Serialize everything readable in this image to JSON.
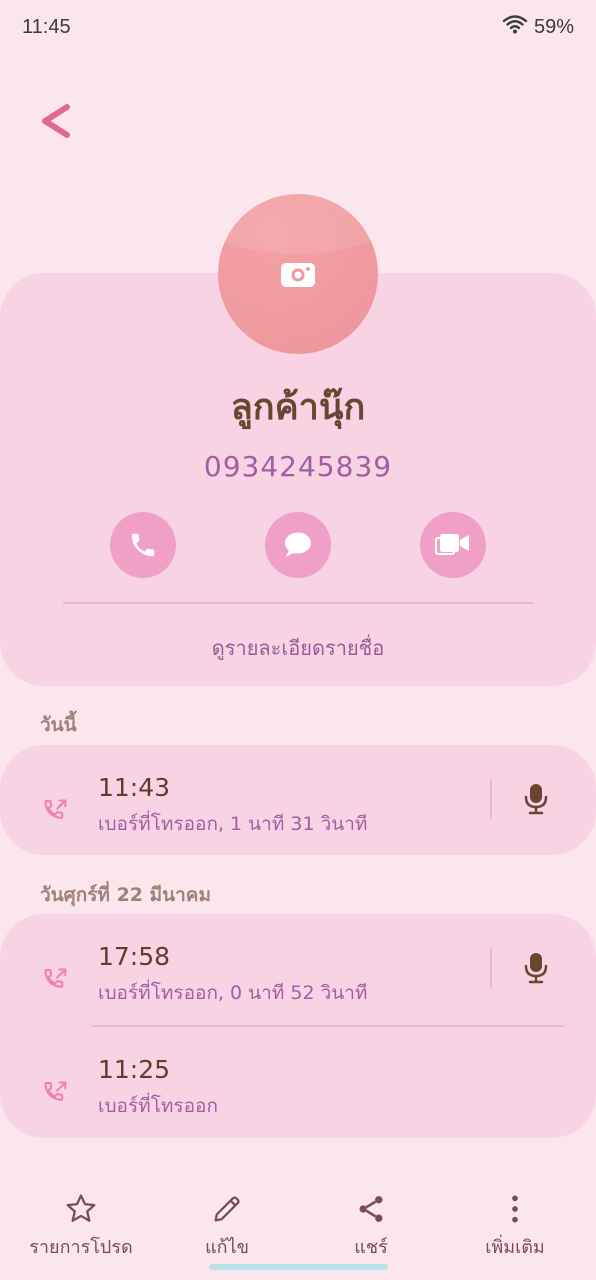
{
  "status": {
    "time": "11:45",
    "battery": "59%"
  },
  "contact": {
    "name": "ลูกค้านุ๊ก",
    "phone": "0934245839",
    "details_label": "ดูรายละเอียดรายชื่อ"
  },
  "sections": [
    {
      "label": "วันนี้",
      "entries": [
        {
          "time": "11:43",
          "desc": "เบอร์ที่โทรออก, 1 นาที 31 วินาที",
          "has_recording": true
        }
      ]
    },
    {
      "label": "วันศุกร์ที่ 22 มีนาคม",
      "entries": [
        {
          "time": "17:58",
          "desc": "เบอร์ที่โทรออก, 0 นาที 52 วินาที",
          "has_recording": true
        },
        {
          "time": "11:25",
          "desc": "เบอร์ที่โทรออก",
          "has_recording": false
        }
      ]
    }
  ],
  "bottom_nav": [
    {
      "label": "รายการโปรด",
      "icon": "star-icon"
    },
    {
      "label": "แก้ไข",
      "icon": "pencil-icon"
    },
    {
      "label": "แชร์",
      "icon": "share-icon"
    },
    {
      "label": "เพิ่มเติม",
      "icon": "more-vertical-icon"
    }
  ],
  "colors": {
    "background": "#fce6ee",
    "card": "#f8d3e3",
    "accent": "#f0a0c6",
    "avatar": "#f09a9f",
    "phone_text": "#a35ea3"
  }
}
